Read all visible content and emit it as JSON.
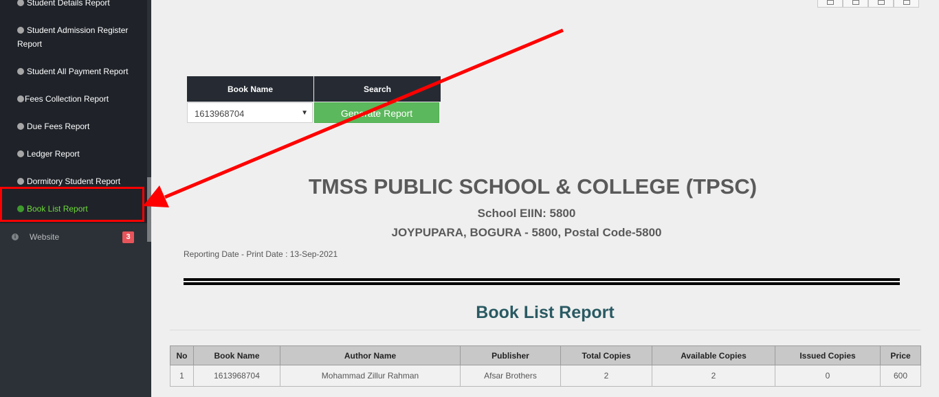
{
  "sidebar": {
    "items": [
      {
        "label": "Student Details Report"
      },
      {
        "label": "Student Admission Register Report"
      },
      {
        "label": "Student All Payment Report"
      },
      {
        "label": "Fees Collection Report"
      },
      {
        "label": "Due Fees Report"
      },
      {
        "label": "Ledger Report"
      },
      {
        "label": "Dormitory Student Report"
      },
      {
        "label": "Book List Report",
        "active": true
      }
    ],
    "website": {
      "label": "Website",
      "icon": "info-icon",
      "badge": "3"
    }
  },
  "search_form": {
    "book_name_header": "Book Name",
    "search_header": "Search",
    "book_name_value": "1613968704",
    "generate_label": "Generate Report"
  },
  "report": {
    "school_name": "TMSS PUBLIC SCHOOL & COLLEGE (TPSC)",
    "eiin": "School EIIN: 5800",
    "address": "JOYPUPARA, BOGURA - 5800, Postal Code-5800",
    "reporting_date": "Reporting Date - Print Date : 13-Sep-2021",
    "title": "Book List Report"
  },
  "table": {
    "columns": [
      "No",
      "Book Name",
      "Author Name",
      "Publisher",
      "Total Copies",
      "Available Copies",
      "Issued Copies",
      "Price"
    ],
    "rows": [
      [
        "1",
        "1613968704",
        "Mohammad Zillur Rahman",
        "Afsar Brothers",
        "2",
        "2",
        "0",
        "600"
      ]
    ]
  },
  "colors": {
    "sidebar_bg": "#2c3137",
    "submenu_bg": "#1f2329",
    "active_item": "#6fdc3b",
    "table_header_bg": "#262b33",
    "generate_button": "#5cb85c",
    "report_title": "#2a5a63",
    "annotation": "#ff0000"
  },
  "toolbar_icons": [
    "image-icon",
    "pdf-icon",
    "user-icon",
    "print-icon"
  ]
}
